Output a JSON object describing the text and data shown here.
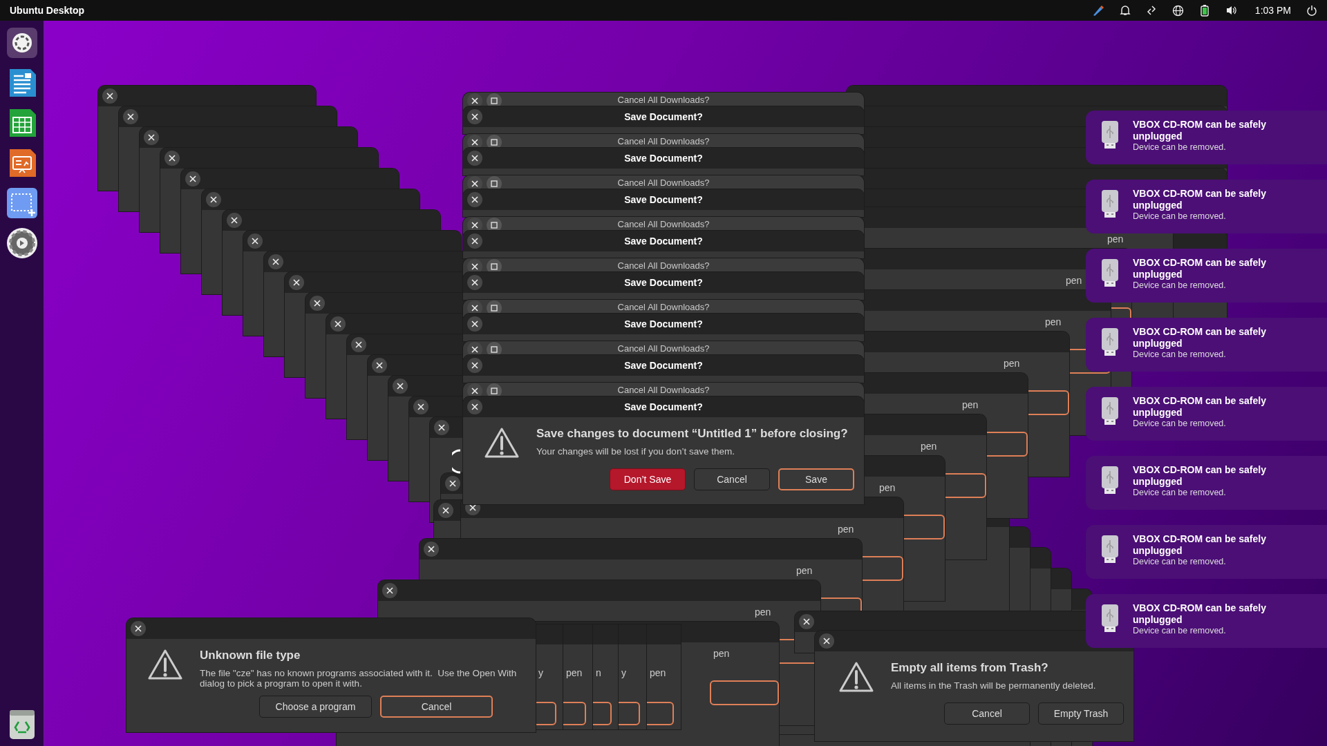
{
  "top_bar": {
    "title": "Ubuntu Desktop",
    "clock": "1:03 PM"
  },
  "save_stack": [
    {
      "back_title": "Cancel All Downloads?",
      "front_title": "Save Document?"
    },
    {
      "back_title": "Cancel All Downloads?",
      "front_title": "Save Document?"
    },
    {
      "back_title": "Cancel All Downloads?",
      "front_title": "Save Document?"
    },
    {
      "back_title": "Cancel All Downloads?",
      "front_title": "Save Document?"
    },
    {
      "back_title": "Cancel All Downloads?",
      "front_title": "Save Document?"
    },
    {
      "back_title": "Cancel All Downloads?",
      "front_title": "Save Document?"
    },
    {
      "back_title": "Cancel All Downloads?",
      "front_title": "Save Document?"
    },
    {
      "back_title": "Cancel All Downloads?",
      "front_title": "Save Document?"
    }
  ],
  "save_dialog": {
    "heading": "Save changes to document “Untitled 1” before closing?",
    "message": "Your changes will be lost if you don’t save them.",
    "buttons": [
      {
        "label": "Don’t Save",
        "kind": "destructive"
      },
      {
        "label": "Cancel",
        "kind": "normal"
      },
      {
        "label": "Save",
        "kind": "suggested"
      }
    ]
  },
  "open_with_stack": [
    {
      "text": "pen"
    },
    {
      "text": "pen"
    },
    {
      "text": "pen"
    },
    {
      "text": "pen"
    },
    {
      "text": "pen"
    },
    {
      "text": "pen"
    },
    {
      "text": "pen"
    },
    {
      "text": "pen"
    },
    {
      "text": "pen"
    },
    {
      "text": "pen"
    },
    {
      "text": "pen"
    }
  ],
  "bottom_fragments": [
    {
      "text": "y"
    },
    {
      "text": "pen"
    },
    {
      "text": "n"
    },
    {
      "text": "y"
    },
    {
      "text": "pen"
    }
  ],
  "unknown_dialog": {
    "heading": "Unknown file type",
    "message": "The file \"cze\" has no known programs associated with it.  Use the Open With dialog to pick a program to open it with.",
    "buttons": [
      {
        "label": "Choose a program",
        "kind": "normal"
      },
      {
        "label": "Cancel",
        "kind": "suggested"
      }
    ]
  },
  "trash_dialog": {
    "heading": "Empty all items from Trash?",
    "message": "All items in the Trash will be permanently deleted.",
    "buttons": [
      {
        "label": "Cancel",
        "kind": "normal"
      },
      {
        "label": "Empty Trash",
        "kind": "normal"
      }
    ]
  },
  "notifications": [
    {
      "title": "VBOX CD-ROM can be safely unplugged",
      "body": "Device can be removed."
    },
    {
      "title": "VBOX CD-ROM can be safely unplugged",
      "body": "Device can be removed."
    },
    {
      "title": "VBOX CD-ROM can be safely unplugged",
      "body": "Device can be removed."
    },
    {
      "title": "VBOX CD-ROM can be safely unplugged",
      "body": "Device can be removed."
    },
    {
      "title": "VBOX CD-ROM can be safely unplugged",
      "body": "Device can be removed."
    },
    {
      "title": "VBOX CD-ROM can be safely unplugged",
      "body": "Device can be removed."
    },
    {
      "title": "VBOX CD-ROM can be safely unplugged",
      "body": "Device can be removed."
    },
    {
      "title": "VBOX CD-ROM can be safely unplugged",
      "body": "Device can be removed."
    }
  ]
}
